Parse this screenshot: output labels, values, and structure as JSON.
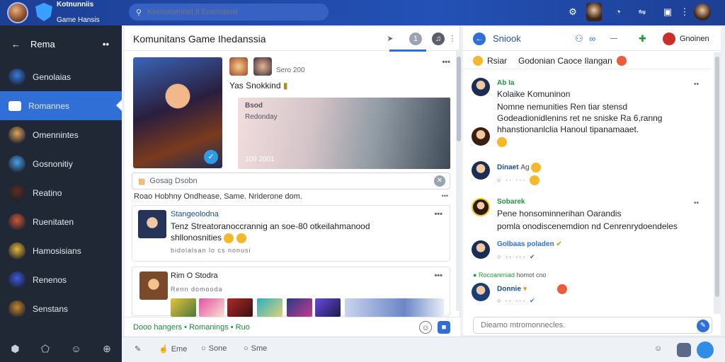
{
  "app": {
    "title_line1": "Kotnunniis",
    "title_line2": "Game Hansis"
  },
  "search": {
    "placeholder": "Komumenitet Il Enemasnii"
  },
  "sidebar": {
    "header": "Rema",
    "items": [
      {
        "label": "Genolaias",
        "color": "#3a7be0"
      },
      {
        "label": "Romannes",
        "color": "#2f6fd6"
      },
      {
        "label": "Omennintes",
        "color": "#e0a35e"
      },
      {
        "label": "Gosnonitiy",
        "color": "#4aa0e8"
      },
      {
        "label": "Reatino",
        "color": "#5b2e24"
      },
      {
        "label": "Ruenitaten",
        "color": "#d0573a"
      },
      {
        "label": "Hamosisians",
        "color": "#e7b93a"
      },
      {
        "label": "Renenos",
        "color": "#3a5be0"
      },
      {
        "label": "Senstans",
        "color": "#c9892f"
      }
    ]
  },
  "center": {
    "title": "Komunitans Game Ihedanssia",
    "badge": "1",
    "card": {
      "date": "Sero 200",
      "title": "Yas Snokkind",
      "preview_title": "Bsod",
      "preview_sub": "Redonday",
      "preview_tag": "109 2001"
    },
    "input_placeholder": "Gosag Dsobn",
    "subbar": "Roao Hobhny  Ondhease, Same.  Nriderone dom.",
    "posts": [
      {
        "author": "Stangeolodna",
        "text_line1": "Tenz Streatoranoccrannig an soe-80 otkeilahmanood",
        "text_line2": "shllonosnities",
        "meta": "bidolalsan lo  cs  nonusi"
      },
      {
        "author": "Rim O Stodra",
        "meta": "Renn domooda"
      }
    ],
    "footer": "Dooo hangers  •  Romanings  •  Ruo"
  },
  "bottombar": {
    "items": [
      "Eme",
      "Sone",
      "Sme"
    ]
  },
  "right": {
    "title": "Sniook",
    "header_right": "Gnoinen",
    "pinned_name": "Rsiar",
    "pinned_text": "Godonian Caoce Ilangan",
    "messages": [
      {
        "name": "Ab Ia",
        "line1": "Kolaike Komuninon",
        "line2": "Nomne nemunities Ren tiar stensd",
        "line3": "Godeadionidlenins ret ne sniske Ra 6,ranng",
        "line4": "hhanstionanlclia Hanoul tipanamaaet."
      },
      {
        "name": "Dinaet",
        "meta": "Ag"
      },
      {
        "name": "Sobarek",
        "line1": "Pene honsominnerihan Oarandis",
        "line2": "pomla onodiscenemdion nd Cenrenrydoendeles"
      },
      {
        "name": "Golbaas",
        "meta": "poladen"
      },
      {
        "name": "Rocoareniad",
        "meta": "homot cno"
      },
      {
        "name": "Donnie"
      }
    ],
    "input_placeholder": "Dieamo mtromonnecles."
  }
}
